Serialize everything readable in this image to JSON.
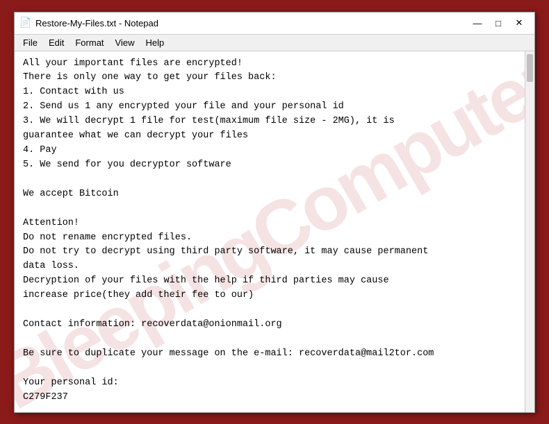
{
  "window": {
    "title": "Restore-My-Files.txt - Notepad",
    "icon": "📄"
  },
  "title_controls": {
    "minimize": "—",
    "maximize": "□",
    "close": "✕"
  },
  "menu": {
    "items": [
      "File",
      "Edit",
      "Format",
      "View",
      "Help"
    ]
  },
  "watermark": {
    "text": "BleepingComputer"
  },
  "content": {
    "text": "All your important files are encrypted!\nThere is only one way to get your files back:\n1. Contact with us\n2. Send us 1 any encrypted your file and your personal id\n3. We will decrypt 1 file for test(maximum file size - 2MG), it is\nguarantee what we can decrypt your files\n4. Pay\n5. We send for you decryptor software\n\nWe accept Bitcoin\n\nAttention!\nDo not rename encrypted files.\nDo not try to decrypt using third party software, it may cause permanent\ndata loss.\nDecryption of your files with the help if third parties may cause\nincrease price(they add their fee to our)\n\nContact information: recoverdata@onionmail.org\n\nBe sure to duplicate your message on the e-mail: recoverdata@mail2tor.com\n\nYour personal id:\nC279F237"
  }
}
